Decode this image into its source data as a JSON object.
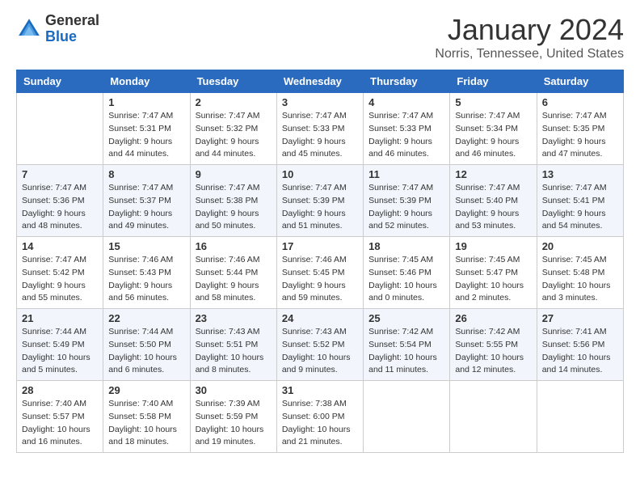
{
  "logo": {
    "general": "General",
    "blue": "Blue"
  },
  "title": "January 2024",
  "location": "Norris, Tennessee, United States",
  "days_of_week": [
    "Sunday",
    "Monday",
    "Tuesday",
    "Wednesday",
    "Thursday",
    "Friday",
    "Saturday"
  ],
  "weeks": [
    [
      {
        "day": "",
        "sunrise": "",
        "sunset": "",
        "daylight": ""
      },
      {
        "day": "1",
        "sunrise": "Sunrise: 7:47 AM",
        "sunset": "Sunset: 5:31 PM",
        "daylight": "Daylight: 9 hours and 44 minutes."
      },
      {
        "day": "2",
        "sunrise": "Sunrise: 7:47 AM",
        "sunset": "Sunset: 5:32 PM",
        "daylight": "Daylight: 9 hours and 44 minutes."
      },
      {
        "day": "3",
        "sunrise": "Sunrise: 7:47 AM",
        "sunset": "Sunset: 5:33 PM",
        "daylight": "Daylight: 9 hours and 45 minutes."
      },
      {
        "day": "4",
        "sunrise": "Sunrise: 7:47 AM",
        "sunset": "Sunset: 5:33 PM",
        "daylight": "Daylight: 9 hours and 46 minutes."
      },
      {
        "day": "5",
        "sunrise": "Sunrise: 7:47 AM",
        "sunset": "Sunset: 5:34 PM",
        "daylight": "Daylight: 9 hours and 46 minutes."
      },
      {
        "day": "6",
        "sunrise": "Sunrise: 7:47 AM",
        "sunset": "Sunset: 5:35 PM",
        "daylight": "Daylight: 9 hours and 47 minutes."
      }
    ],
    [
      {
        "day": "7",
        "sunrise": "Sunrise: 7:47 AM",
        "sunset": "Sunset: 5:36 PM",
        "daylight": "Daylight: 9 hours and 48 minutes."
      },
      {
        "day": "8",
        "sunrise": "Sunrise: 7:47 AM",
        "sunset": "Sunset: 5:37 PM",
        "daylight": "Daylight: 9 hours and 49 minutes."
      },
      {
        "day": "9",
        "sunrise": "Sunrise: 7:47 AM",
        "sunset": "Sunset: 5:38 PM",
        "daylight": "Daylight: 9 hours and 50 minutes."
      },
      {
        "day": "10",
        "sunrise": "Sunrise: 7:47 AM",
        "sunset": "Sunset: 5:39 PM",
        "daylight": "Daylight: 9 hours and 51 minutes."
      },
      {
        "day": "11",
        "sunrise": "Sunrise: 7:47 AM",
        "sunset": "Sunset: 5:39 PM",
        "daylight": "Daylight: 9 hours and 52 minutes."
      },
      {
        "day": "12",
        "sunrise": "Sunrise: 7:47 AM",
        "sunset": "Sunset: 5:40 PM",
        "daylight": "Daylight: 9 hours and 53 minutes."
      },
      {
        "day": "13",
        "sunrise": "Sunrise: 7:47 AM",
        "sunset": "Sunset: 5:41 PM",
        "daylight": "Daylight: 9 hours and 54 minutes."
      }
    ],
    [
      {
        "day": "14",
        "sunrise": "Sunrise: 7:47 AM",
        "sunset": "Sunset: 5:42 PM",
        "daylight": "Daylight: 9 hours and 55 minutes."
      },
      {
        "day": "15",
        "sunrise": "Sunrise: 7:46 AM",
        "sunset": "Sunset: 5:43 PM",
        "daylight": "Daylight: 9 hours and 56 minutes."
      },
      {
        "day": "16",
        "sunrise": "Sunrise: 7:46 AM",
        "sunset": "Sunset: 5:44 PM",
        "daylight": "Daylight: 9 hours and 58 minutes."
      },
      {
        "day": "17",
        "sunrise": "Sunrise: 7:46 AM",
        "sunset": "Sunset: 5:45 PM",
        "daylight": "Daylight: 9 hours and 59 minutes."
      },
      {
        "day": "18",
        "sunrise": "Sunrise: 7:45 AM",
        "sunset": "Sunset: 5:46 PM",
        "daylight": "Daylight: 10 hours and 0 minutes."
      },
      {
        "day": "19",
        "sunrise": "Sunrise: 7:45 AM",
        "sunset": "Sunset: 5:47 PM",
        "daylight": "Daylight: 10 hours and 2 minutes."
      },
      {
        "day": "20",
        "sunrise": "Sunrise: 7:45 AM",
        "sunset": "Sunset: 5:48 PM",
        "daylight": "Daylight: 10 hours and 3 minutes."
      }
    ],
    [
      {
        "day": "21",
        "sunrise": "Sunrise: 7:44 AM",
        "sunset": "Sunset: 5:49 PM",
        "daylight": "Daylight: 10 hours and 5 minutes."
      },
      {
        "day": "22",
        "sunrise": "Sunrise: 7:44 AM",
        "sunset": "Sunset: 5:50 PM",
        "daylight": "Daylight: 10 hours and 6 minutes."
      },
      {
        "day": "23",
        "sunrise": "Sunrise: 7:43 AM",
        "sunset": "Sunset: 5:51 PM",
        "daylight": "Daylight: 10 hours and 8 minutes."
      },
      {
        "day": "24",
        "sunrise": "Sunrise: 7:43 AM",
        "sunset": "Sunset: 5:52 PM",
        "daylight": "Daylight: 10 hours and 9 minutes."
      },
      {
        "day": "25",
        "sunrise": "Sunrise: 7:42 AM",
        "sunset": "Sunset: 5:54 PM",
        "daylight": "Daylight: 10 hours and 11 minutes."
      },
      {
        "day": "26",
        "sunrise": "Sunrise: 7:42 AM",
        "sunset": "Sunset: 5:55 PM",
        "daylight": "Daylight: 10 hours and 12 minutes."
      },
      {
        "day": "27",
        "sunrise": "Sunrise: 7:41 AM",
        "sunset": "Sunset: 5:56 PM",
        "daylight": "Daylight: 10 hours and 14 minutes."
      }
    ],
    [
      {
        "day": "28",
        "sunrise": "Sunrise: 7:40 AM",
        "sunset": "Sunset: 5:57 PM",
        "daylight": "Daylight: 10 hours and 16 minutes."
      },
      {
        "day": "29",
        "sunrise": "Sunrise: 7:40 AM",
        "sunset": "Sunset: 5:58 PM",
        "daylight": "Daylight: 10 hours and 18 minutes."
      },
      {
        "day": "30",
        "sunrise": "Sunrise: 7:39 AM",
        "sunset": "Sunset: 5:59 PM",
        "daylight": "Daylight: 10 hours and 19 minutes."
      },
      {
        "day": "31",
        "sunrise": "Sunrise: 7:38 AM",
        "sunset": "Sunset: 6:00 PM",
        "daylight": "Daylight: 10 hours and 21 minutes."
      },
      {
        "day": "",
        "sunrise": "",
        "sunset": "",
        "daylight": ""
      },
      {
        "day": "",
        "sunrise": "",
        "sunset": "",
        "daylight": ""
      },
      {
        "day": "",
        "sunrise": "",
        "sunset": "",
        "daylight": ""
      }
    ]
  ]
}
